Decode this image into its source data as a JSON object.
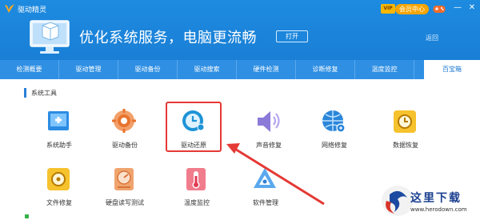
{
  "app": {
    "title": "驱动精灵"
  },
  "header": {
    "vip_badge": "VIP",
    "member_button": "会员中心",
    "minimize": "—",
    "close": "✕",
    "slogan": "优化系统服务，电脑更流畅",
    "open_button": "打开",
    "return_link": "返回"
  },
  "nav": {
    "tabs": [
      {
        "label": "检测概要"
      },
      {
        "label": "驱动管理"
      },
      {
        "label": "驱动备份"
      },
      {
        "label": "驱动搜索"
      },
      {
        "label": "硬件检测"
      },
      {
        "label": "诊断修复"
      },
      {
        "label": "温度监控"
      },
      {
        "label": "百宝箱",
        "active": true
      }
    ]
  },
  "section": {
    "title": "系统工具"
  },
  "tools": [
    {
      "label": "系统助手",
      "icon": "system-assistant-icon"
    },
    {
      "label": "驱动备份",
      "icon": "driver-backup-icon"
    },
    {
      "label": "驱动还原",
      "icon": "driver-restore-icon",
      "highlighted": true
    },
    {
      "label": "声音修复",
      "icon": "sound-repair-icon"
    },
    {
      "label": "网络修复",
      "icon": "network-repair-icon"
    },
    {
      "label": "数据恢复",
      "icon": "data-recovery-icon"
    },
    {
      "label": "文件修复",
      "icon": "file-repair-icon"
    },
    {
      "label": "硬盘读写测试",
      "icon": "disk-test-icon"
    },
    {
      "label": "温度监控",
      "icon": "temperature-monitor-icon"
    },
    {
      "label": "软件管理",
      "icon": "software-manager-icon"
    }
  ],
  "watermark": {
    "text": "这里下载",
    "url": "www.herodown.com"
  },
  "colors": {
    "header_blue": "#1a7fd6",
    "nav_blue": "#2f8fe3",
    "highlight_red": "#e53935",
    "accent_orange": "#f6a500"
  }
}
